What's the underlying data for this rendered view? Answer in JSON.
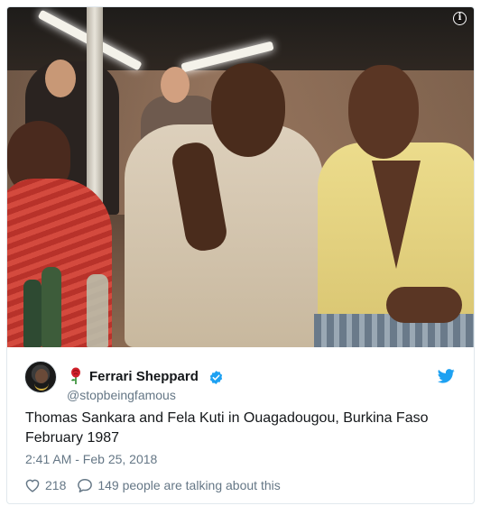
{
  "tweet": {
    "author": {
      "display_name": "Ferrari Sheppard",
      "handle": "@stopbeingfamous",
      "verified": true,
      "name_emoji": "rose-icon"
    },
    "text_lines": [
      "Thomas Sankara and Fela Kuti in Ouagadougou, Burkina Faso",
      "February 1987"
    ],
    "timestamp": "2:41 AM - Feb 25, 2018",
    "likes": "218",
    "conversation": "149 people are talking about this"
  },
  "icons": {
    "info": "info-icon",
    "bird": "twitter-bird-icon",
    "heart": "heart-icon",
    "reply": "speech-bubble-icon",
    "verified": "verified-badge-icon"
  },
  "colors": {
    "twitter_blue": "#1da1f2",
    "text_primary": "#14171a",
    "text_secondary": "#657786",
    "border": "#e1e8ed",
    "rose_red": "#d0202a"
  }
}
